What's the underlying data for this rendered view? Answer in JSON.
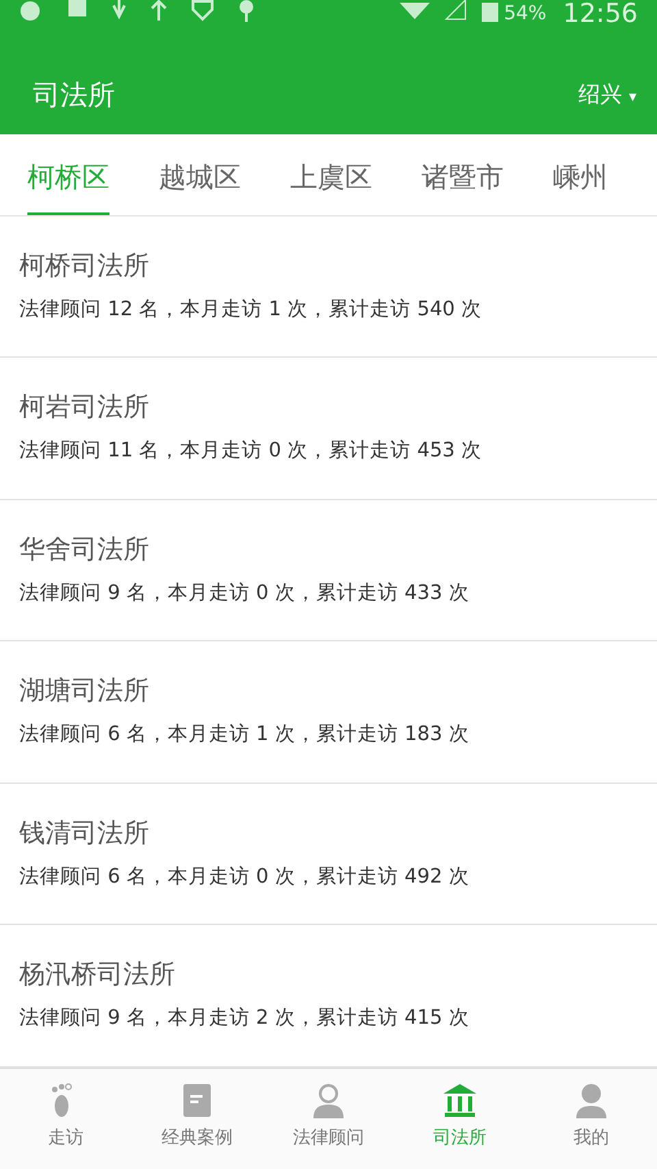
{
  "status_bar": {
    "battery": "54%",
    "time": "12:56"
  },
  "header": {
    "title": "司法所",
    "city": "绍兴",
    "city_caret": "▾"
  },
  "tabs": [
    {
      "label": "柯桥区",
      "selected": true
    },
    {
      "label": "越城区",
      "selected": false
    },
    {
      "label": "上虞区",
      "selected": false
    },
    {
      "label": "诸暨市",
      "selected": false
    },
    {
      "label": "嵊州",
      "selected": false
    }
  ],
  "offices": [
    {
      "name": "柯桥司法所",
      "stats": "法律顾问 12 名，本月走访 1 次，累计走访 540 次"
    },
    {
      "name": "柯岩司法所",
      "stats": "法律顾问 11 名，本月走访 0 次，累计走访 453 次"
    },
    {
      "name": "华舍司法所",
      "stats": "法律顾问 9 名，本月走访 0 次，累计走访 433 次"
    },
    {
      "name": "湖塘司法所",
      "stats": "法律顾问 6 名，本月走访 1 次，累计走访 183 次"
    },
    {
      "name": "钱清司法所",
      "stats": "法律顾问 6 名，本月走访 0 次，累计走访 492 次"
    },
    {
      "name": "杨汛桥司法所",
      "stats": "法律顾问 9 名，本月走访 2 次，累计走访 415 次"
    }
  ],
  "bottom_nav": [
    {
      "label": "走访",
      "kind": "foot",
      "selected": false
    },
    {
      "label": "经典案例",
      "kind": "book",
      "selected": false
    },
    {
      "label": "法律顾问",
      "kind": "person",
      "selected": false
    },
    {
      "label": "司法所",
      "kind": "bank",
      "selected": true
    },
    {
      "label": "我的",
      "kind": "user",
      "selected": false
    }
  ]
}
